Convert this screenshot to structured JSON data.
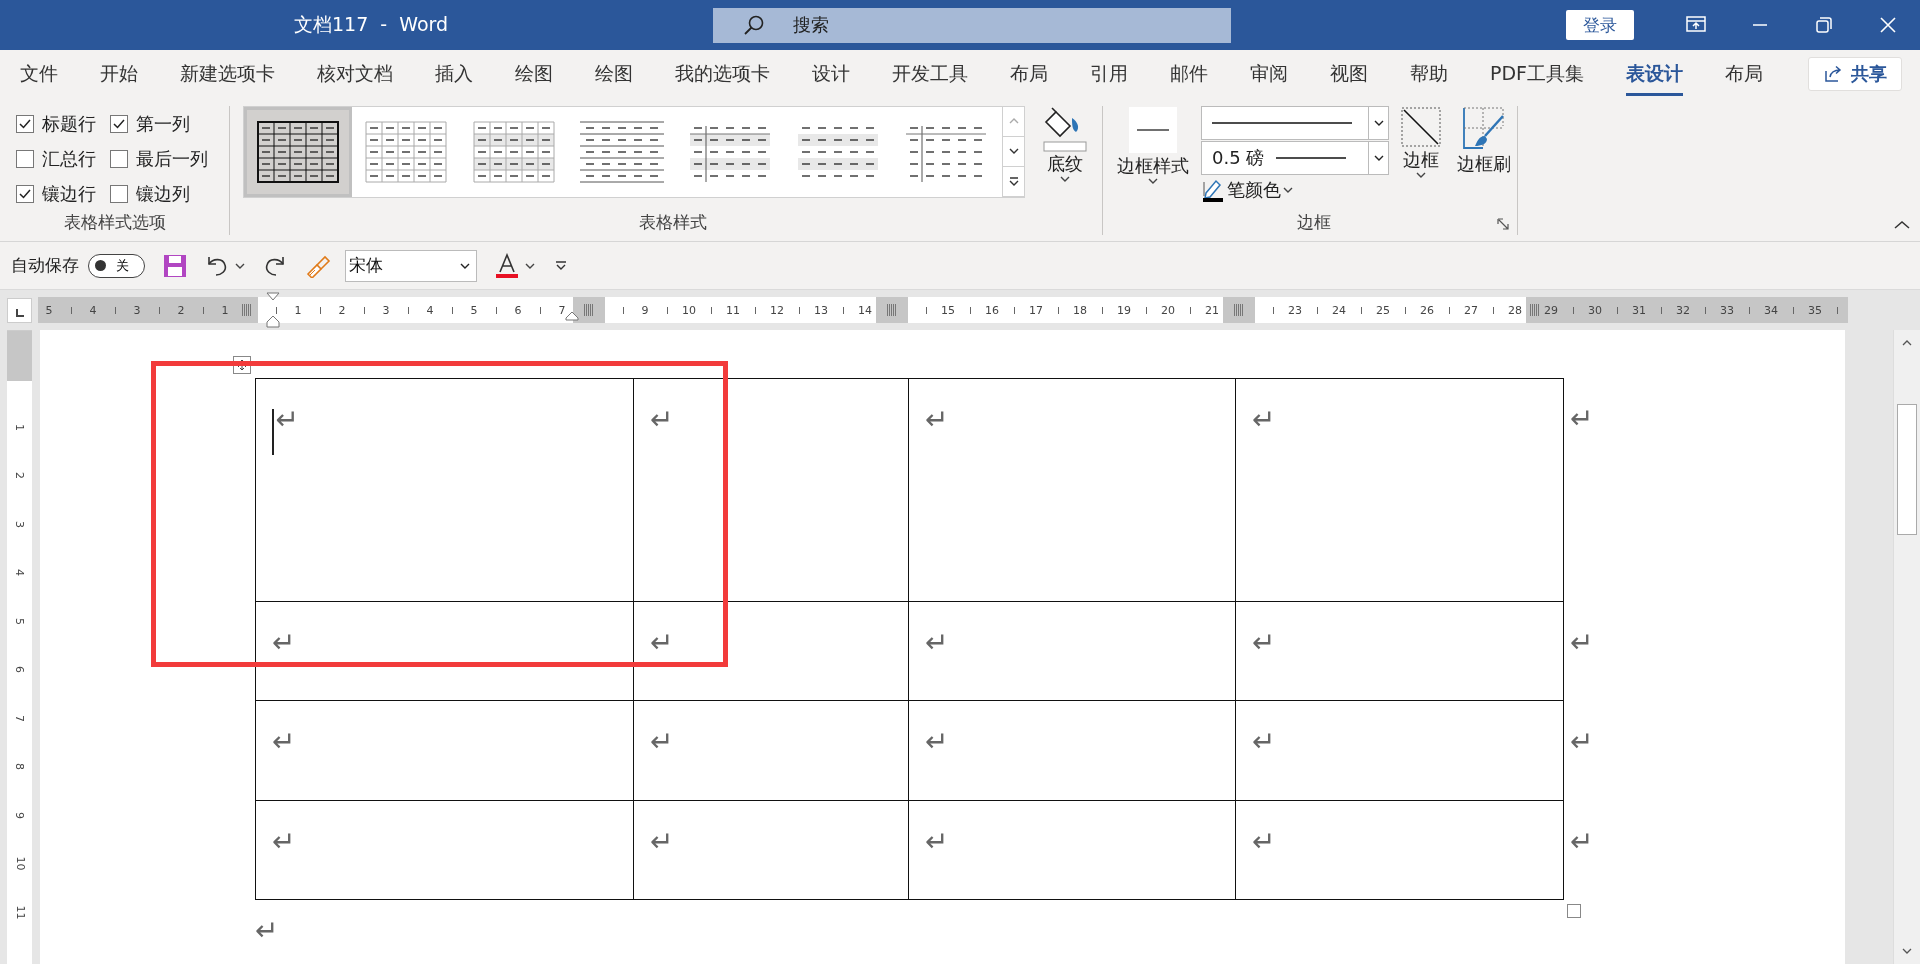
{
  "window": {
    "title": "文档117  -  Word",
    "search_placeholder": "搜索",
    "sign_in": "登录"
  },
  "tabs": [
    {
      "label": "文件",
      "selected": false
    },
    {
      "label": "开始",
      "selected": false
    },
    {
      "label": "新建选项卡",
      "selected": false
    },
    {
      "label": "核对文档",
      "selected": false
    },
    {
      "label": "插入",
      "selected": false
    },
    {
      "label": "绘图",
      "selected": false
    },
    {
      "label": "绘图",
      "selected": false
    },
    {
      "label": "我的选项卡",
      "selected": false
    },
    {
      "label": "设计",
      "selected": false
    },
    {
      "label": "开发工具",
      "selected": false
    },
    {
      "label": "布局",
      "selected": false
    },
    {
      "label": "引用",
      "selected": false
    },
    {
      "label": "邮件",
      "selected": false
    },
    {
      "label": "审阅",
      "selected": false
    },
    {
      "label": "视图",
      "selected": false
    },
    {
      "label": "帮助",
      "selected": false
    },
    {
      "label": "PDF工具集",
      "selected": false
    },
    {
      "label": "表设计",
      "selected": true
    },
    {
      "label": "布局",
      "selected": false
    }
  ],
  "share_button": "共享",
  "ribbon": {
    "table_style_options": {
      "label": "表格样式选项",
      "options": [
        {
          "label": "标题行",
          "checked": true
        },
        {
          "label": "第一列",
          "checked": true
        },
        {
          "label": "汇总行",
          "checked": false
        },
        {
          "label": "最后一列",
          "checked": false
        },
        {
          "label": "镶边行",
          "checked": true
        },
        {
          "label": "镶边列",
          "checked": false
        }
      ]
    },
    "table_styles": {
      "label": "表格样式",
      "styles": [
        {
          "kind": "grid",
          "selected": true
        },
        {
          "kind": "light-grid",
          "selected": false
        },
        {
          "kind": "shaded-grid",
          "selected": false
        },
        {
          "kind": "horizontal-lines",
          "selected": false
        },
        {
          "kind": "banded-first-column",
          "selected": false
        },
        {
          "kind": "banded-rows",
          "selected": false
        },
        {
          "kind": "first-column-line",
          "selected": false
        }
      ],
      "shading_button": "底纹"
    },
    "borders": {
      "label": "边框",
      "border_styles_button": "边框样式",
      "line_weight": "0.5 磅",
      "pen_color_button": "笔颜色",
      "borders_button": "边框",
      "border_painter_button": "边框刷"
    }
  },
  "quick_access": {
    "autosave_label": "自动保存",
    "autosave_on": false,
    "autosave_state": "关",
    "font": "宋体"
  },
  "ruler": {
    "segments": [
      {
        "kind": "margin-left",
        "labels": [
          "5",
          "4",
          "3",
          "2",
          "1"
        ]
      },
      {
        "kind": "text",
        "labels": [
          "1",
          "2",
          "3",
          "4",
          "5",
          "6",
          "7"
        ]
      },
      {
        "kind": "column-marker"
      },
      {
        "kind": "text",
        "labels": [
          "9",
          "10",
          "11",
          "12",
          "13",
          "14"
        ]
      },
      {
        "kind": "column-marker"
      },
      {
        "kind": "text",
        "labels": [
          "15",
          "16",
          "17",
          "18",
          "19",
          "20",
          "21"
        ]
      },
      {
        "kind": "column-marker"
      },
      {
        "kind": "text",
        "labels": [
          "23",
          "24",
          "25",
          "26",
          "27",
          "28"
        ]
      },
      {
        "kind": "margin-right",
        "labels": [
          "29",
          "30",
          "31",
          "32",
          "33",
          "34",
          "35"
        ]
      }
    ]
  },
  "vertical_ruler": {
    "labels": [
      "1",
      "2",
      "3",
      "4",
      "5",
      "6",
      "7",
      "8",
      "9",
      "10",
      "11"
    ]
  },
  "document": {
    "table": {
      "rows": [
        {
          "cells": [
            "↵",
            "↵",
            "↵",
            "↵"
          ],
          "end_mark": "↵"
        },
        {
          "cells": [
            "↵",
            "↵",
            "↵",
            "↵"
          ],
          "end_mark": "↵"
        },
        {
          "cells": [
            "↵",
            "↵",
            "↵",
            "↵"
          ],
          "end_mark": "↵"
        },
        {
          "cells": [
            "↵",
            "↵",
            "↵",
            "↵"
          ],
          "end_mark": "↵"
        }
      ]
    },
    "cursor_in_first_cell": true,
    "trailing_mark": "↵"
  },
  "annotations": [
    {
      "kind": "rectangle"
    }
  ]
}
